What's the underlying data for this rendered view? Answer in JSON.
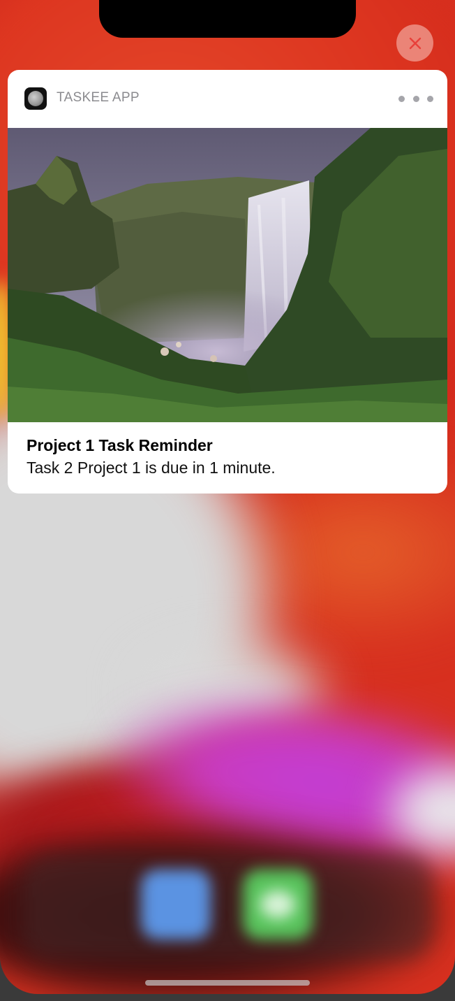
{
  "notification": {
    "app_name": "TASKEE APP",
    "app_icon": "moon-icon",
    "title": "Project 1 Task Reminder",
    "body": "Task 2 Project 1 is due in 1 minute.",
    "image": "waterfall-photo",
    "more_icon": "ellipsis-icon"
  },
  "controls": {
    "close_icon": "close-icon"
  },
  "dock": {
    "apps": [
      "blurred-app-blue",
      "blurred-app-green"
    ]
  },
  "colors": {
    "wallpaper_red": "#d7301f",
    "close_button": "#f0a096",
    "card_bg": "#ffffff",
    "app_name_text": "#8b8b8f"
  }
}
